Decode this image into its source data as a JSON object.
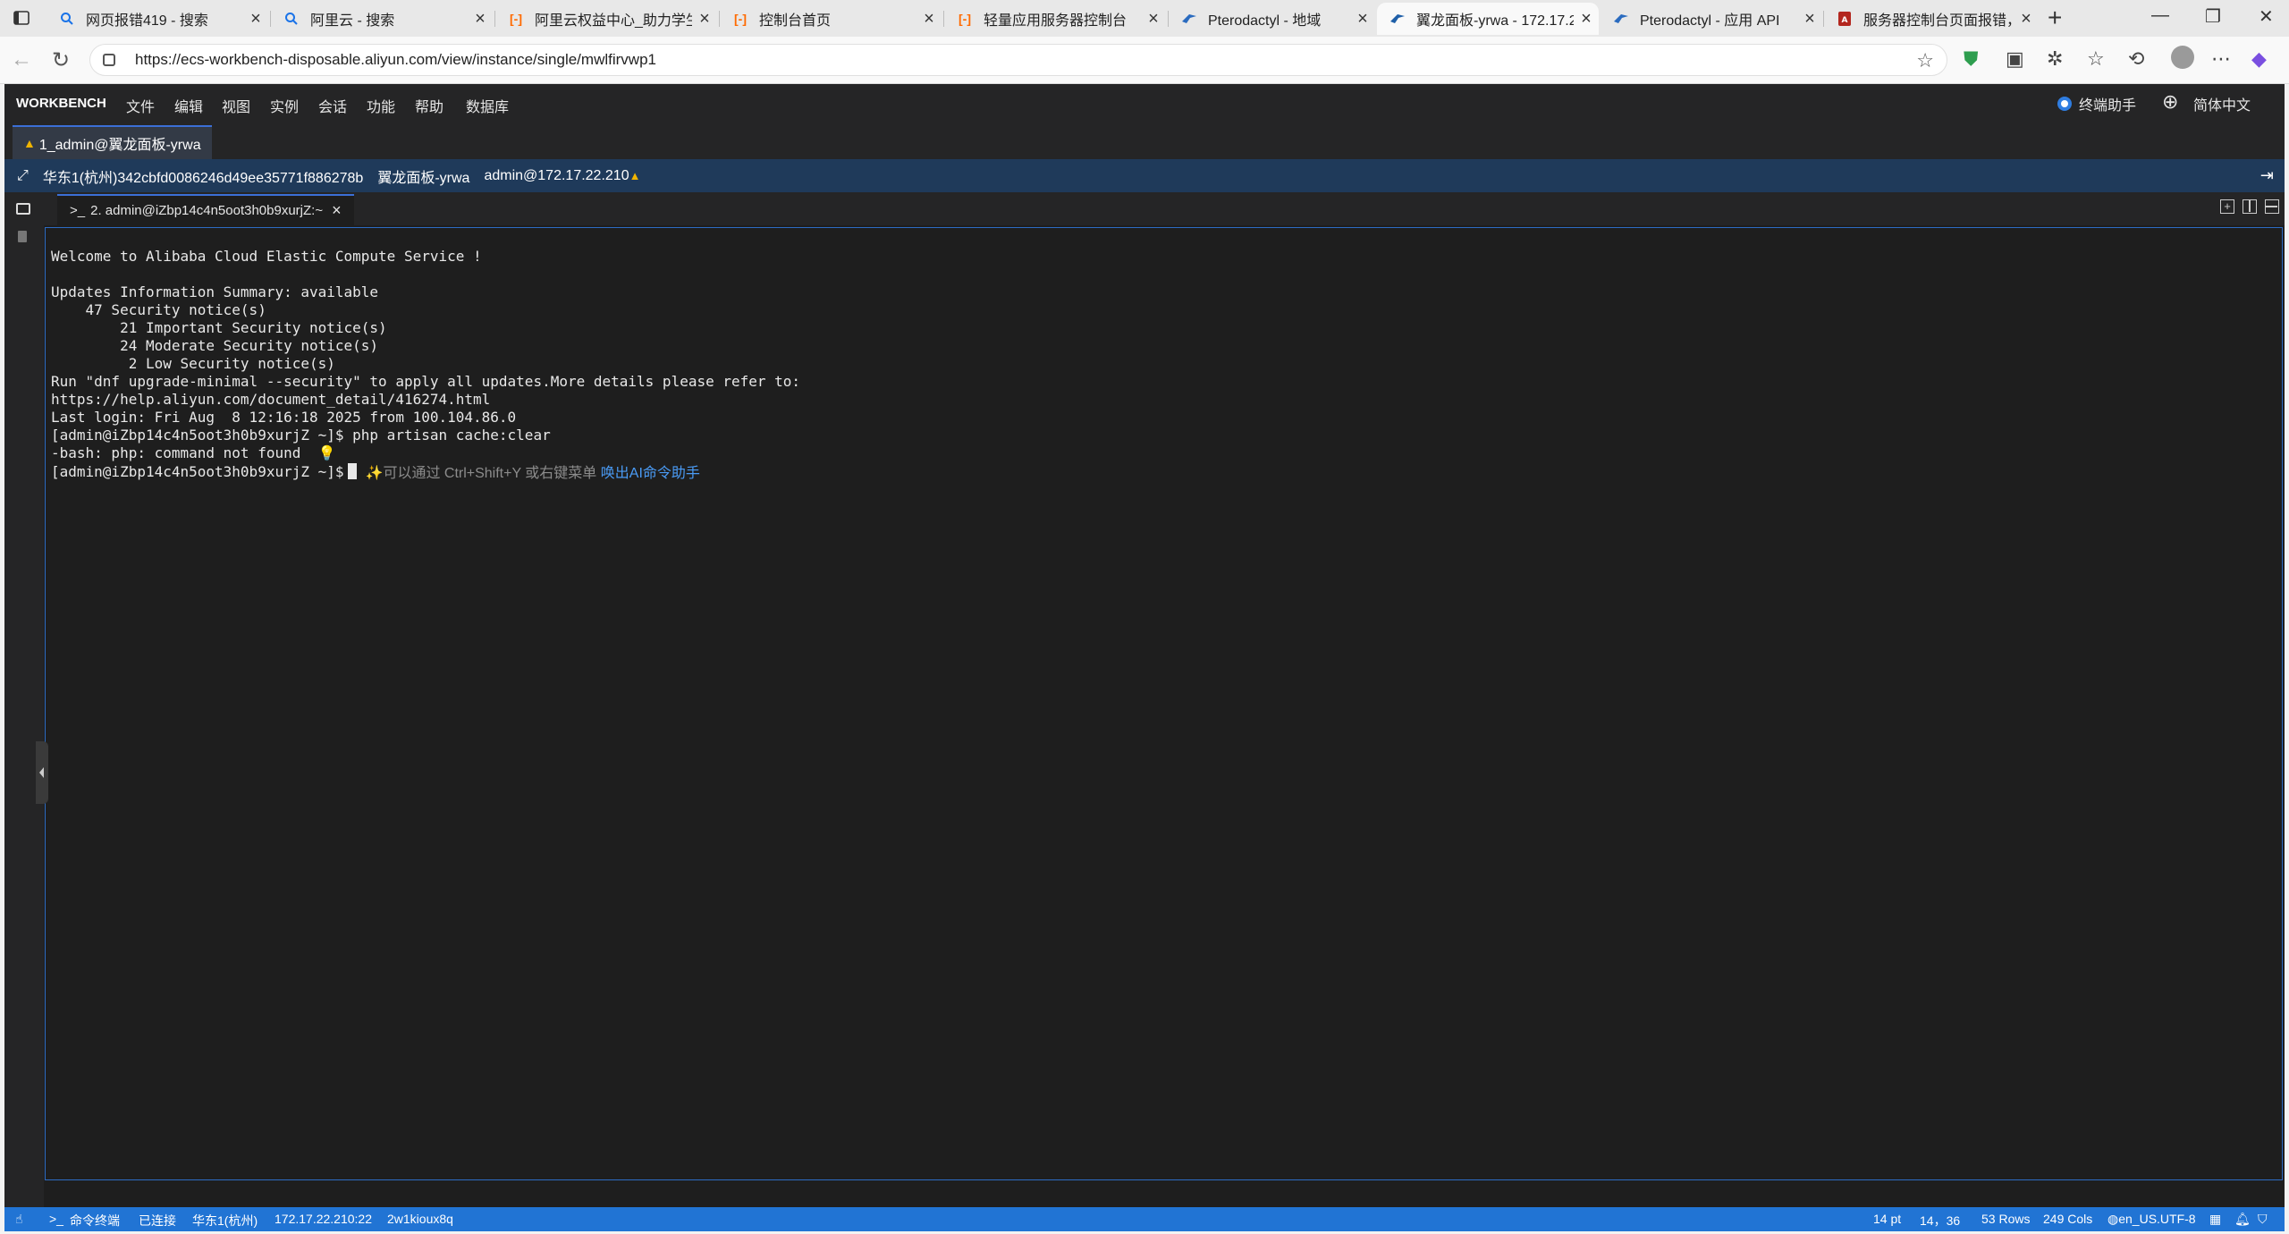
{
  "browser": {
    "tabs": [
      {
        "title": "网页报错419 - 搜索",
        "icon": "search-icon",
        "active": false
      },
      {
        "title": "阿里云 - 搜索",
        "icon": "search-icon",
        "active": false
      },
      {
        "title": "阿里云权益中心_助力学生",
        "icon": "aliyun-icon",
        "active": false
      },
      {
        "title": "控制台首页",
        "icon": "aliyun-icon",
        "active": false
      },
      {
        "title": "轻量应用服务器控制台",
        "icon": "aliyun-icon",
        "active": false
      },
      {
        "title": "Pterodactyl - 地域",
        "icon": "pterodactyl-icon",
        "active": false
      },
      {
        "title": "翼龙面板-yrwa - 172.17.2",
        "icon": "workbench-icon",
        "active": true
      },
      {
        "title": "Pterodactyl - 应用 API",
        "icon": "pterodactyl-icon",
        "active": false
      },
      {
        "title": "服务器控制台页面报错，",
        "icon": "pdf-icon",
        "active": false
      }
    ],
    "url": "https://ecs-workbench-disposable.aliyun.com/view/instance/single/mwlfirvwp1"
  },
  "workbench": {
    "brand": "WORKBENCH",
    "menu": [
      "文件",
      "编辑",
      "视图",
      "实例",
      "会话",
      "功能",
      "帮助",
      "数据库"
    ],
    "assistant_label": "终端助手",
    "language": "简体中文",
    "session_tab": "1_admin@翼龙面板-yrwa",
    "info": {
      "region_instance": "华东1(杭州)342cbfd0086246d49ee35771f886278b",
      "instance_name": "翼龙面板-yrwa",
      "login": "admin@172.17.22.210"
    },
    "terminal_tab": "2. admin@iZbp14c4n5oot3h0b9xurjZ:~",
    "terminal": {
      "lines": [
        "Welcome to Alibaba Cloud Elastic Compute Service !",
        "",
        "Updates Information Summary: available",
        "    47 Security notice(s)",
        "        21 Important Security notice(s)",
        "        24 Moderate Security notice(s)",
        "         2 Low Security notice(s)",
        "Run \"dnf upgrade-minimal --security\" to apply all updates.More details please refer to:",
        "https://help.aliyun.com/document_detail/416274.html",
        "Last login: Fri Aug  8 12:16:18 2025 from 100.104.86.0",
        "[admin@iZbp14c4n5oot3h0b9xurjZ ~]$ php artisan cache:clear",
        "-bash: php: command not found"
      ],
      "prompt": "[admin@iZbp14c4n5oot3h0b9xurjZ ~]$",
      "hint": "✨可以通过 Ctrl+Shift+Y 或右键菜单",
      "hint_link": "唤出AI命令助手"
    },
    "status": {
      "terminal_label": "命令终端",
      "connection": "已连接",
      "region": "华东1(杭州)",
      "address": "172.17.22.210:22",
      "session_id": "2w1kioux8q",
      "font_size": "14 pt",
      "cursor_pos": "14，36",
      "rows": "53 Rows",
      "cols": "249 Cols",
      "encoding": "en_US.UTF-8"
    }
  },
  "colors": {
    "terminal_bg": "#1e1e1e",
    "status_bar": "#2174d4",
    "info_bar": "#1f3a5a",
    "link": "#4a9bf5"
  }
}
